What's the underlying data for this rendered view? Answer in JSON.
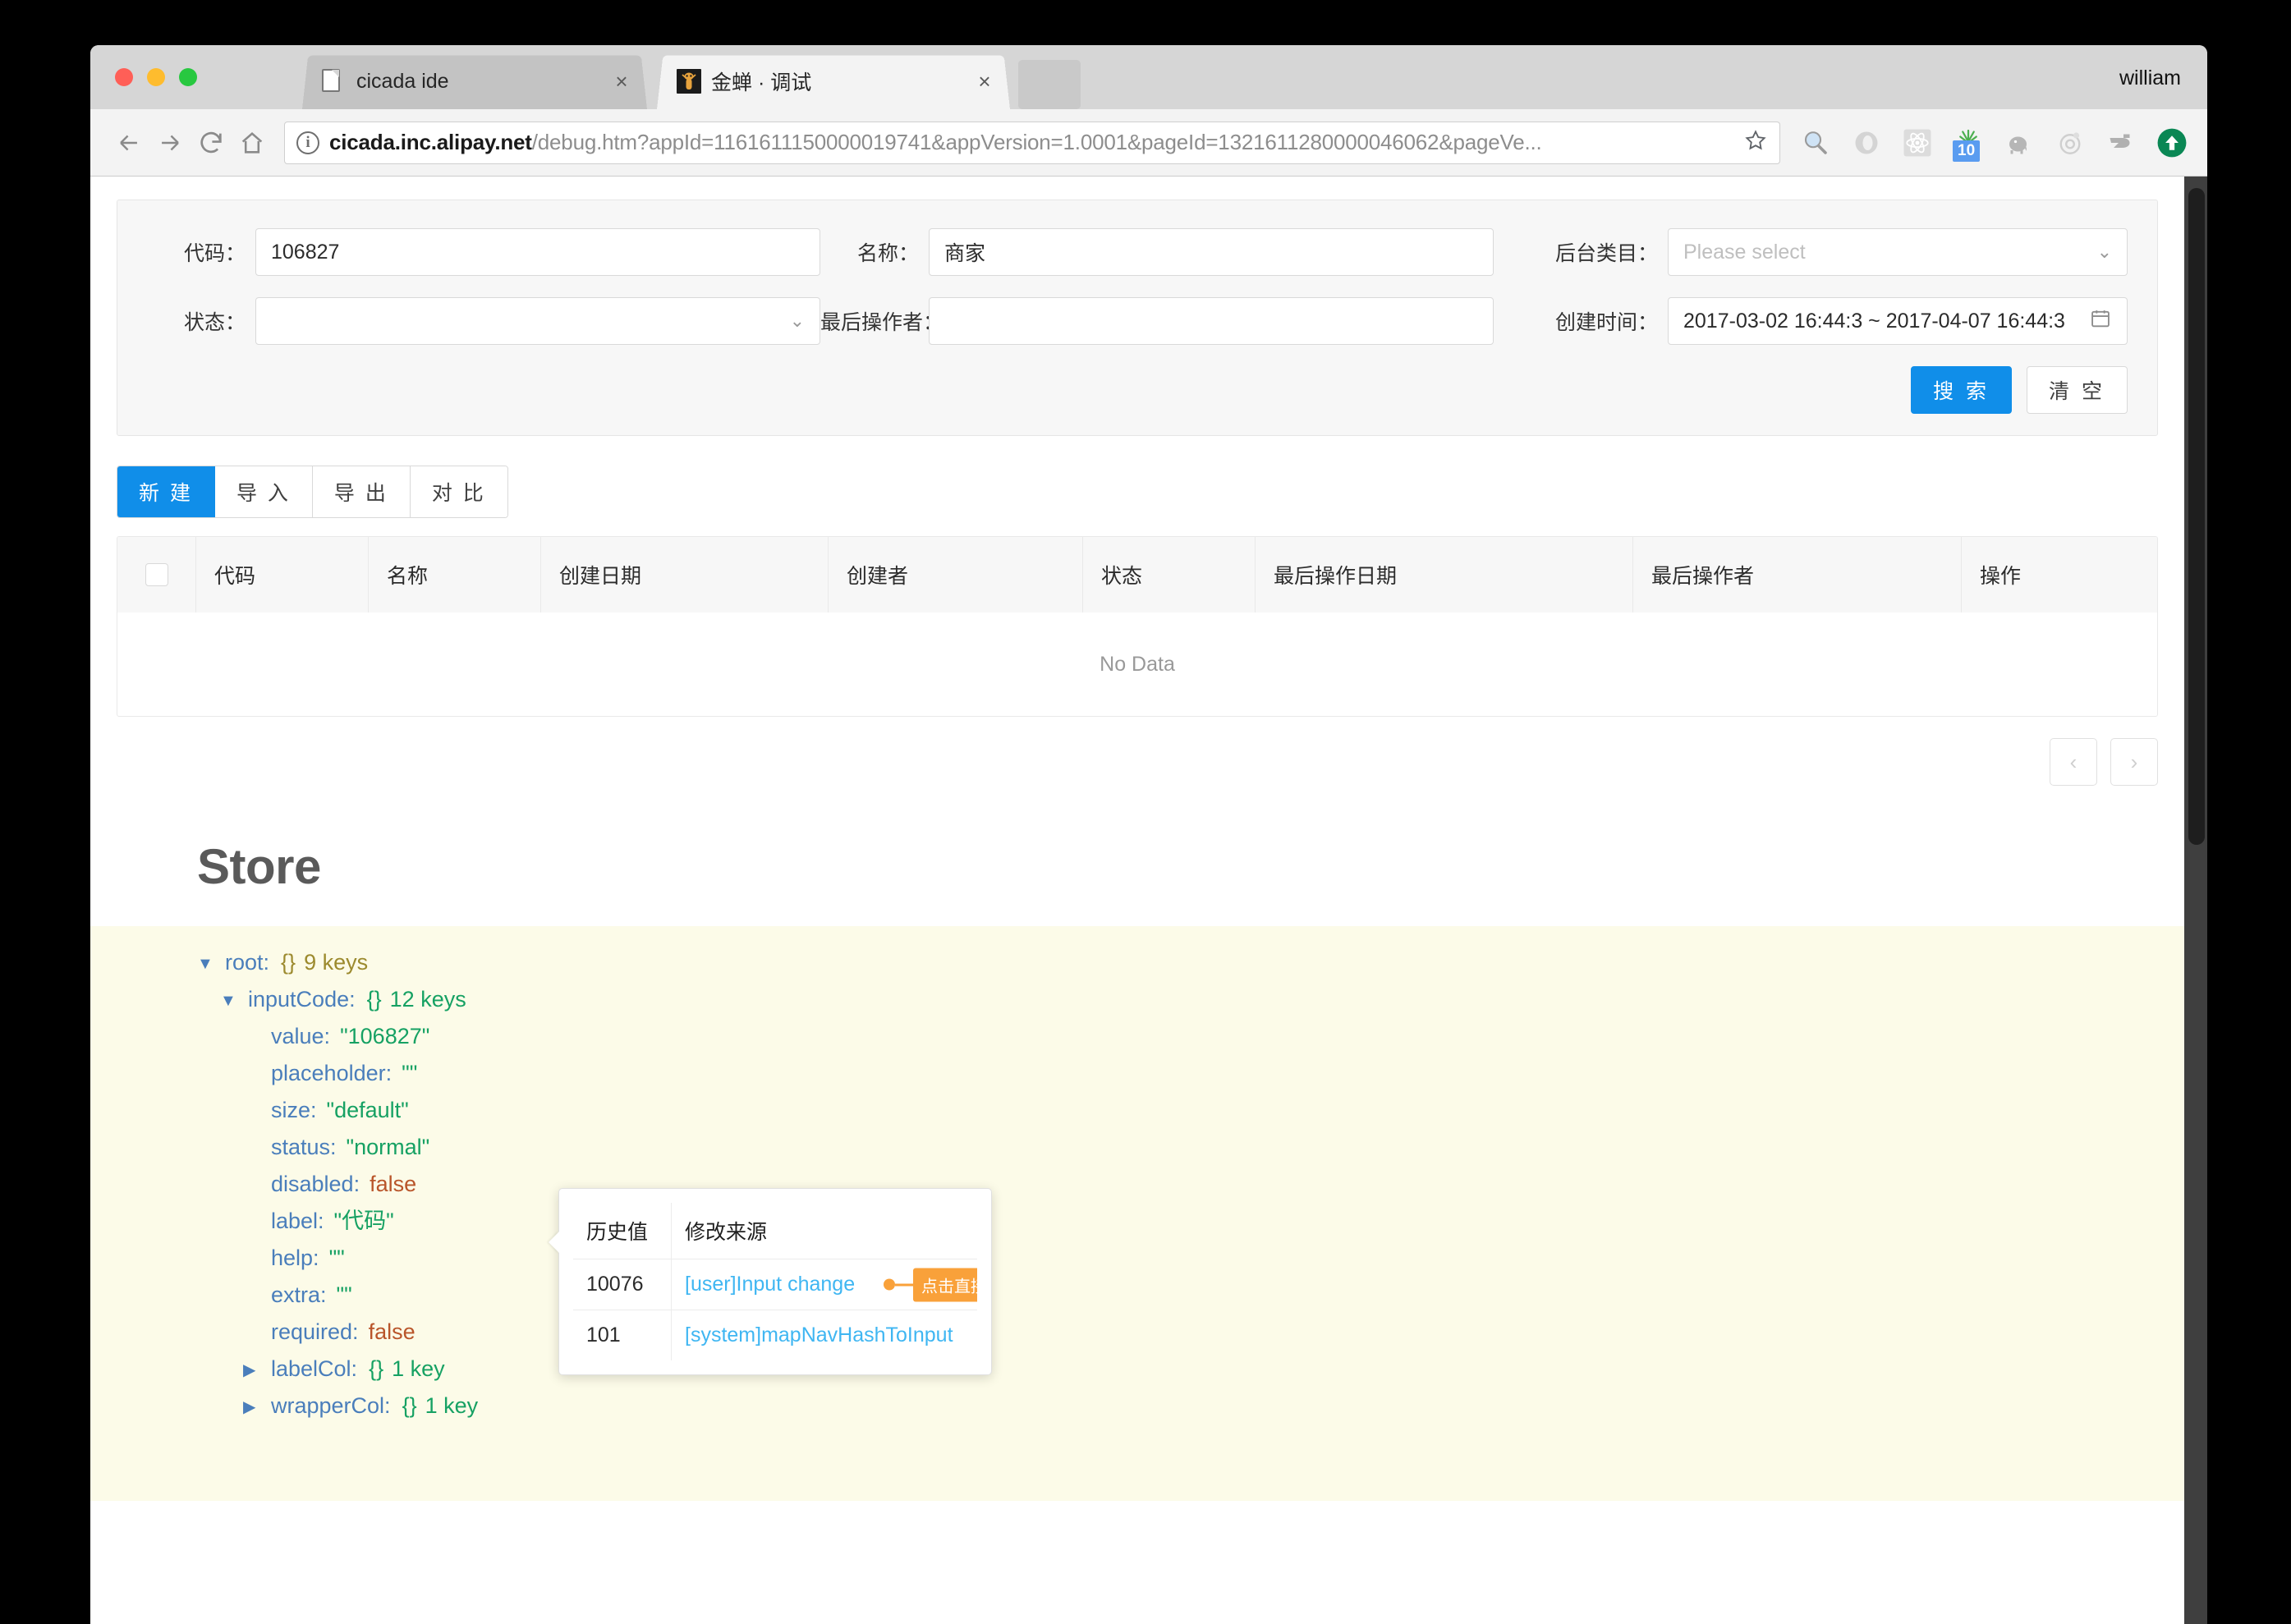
{
  "browser": {
    "profile_name": "william",
    "tabs": [
      {
        "title": "cicada ide",
        "favicon": "document-icon",
        "active": false,
        "close_label": "×"
      },
      {
        "title": "金蝉 · 调试",
        "favicon": "cicada-logo-icon",
        "active": true,
        "close_label": "×"
      }
    ],
    "new_tab_label": "",
    "omnibox": {
      "security_icon": "info-circle-icon",
      "host": "cicada.inc.alipay.net",
      "path": "/debug.htm?appId=1161611150000019741&appVersion=1.0001&pageId=1321611280000046062&pageVe...",
      "star_icon": "star-icon"
    },
    "nav": {
      "back_icon": "back-arrow-icon",
      "forward_icon": "forward-arrow-icon",
      "reload_icon": "reload-icon",
      "home_icon": "home-icon"
    },
    "extensions": [
      {
        "name": "magnifier-extension-icon",
        "badge": ""
      },
      {
        "name": "ring-extension-icon",
        "badge": ""
      },
      {
        "name": "react-devtools-icon",
        "badge": ""
      },
      {
        "name": "grass-extension-icon",
        "badge": "10"
      },
      {
        "name": "elephant-extension-icon",
        "badge": ""
      },
      {
        "name": "target-extension-icon",
        "badge": ""
      },
      {
        "name": "logo-extension-icon",
        "badge": ""
      },
      {
        "name": "upload-extension-icon",
        "badge": ""
      }
    ]
  },
  "search_form": {
    "fields": [
      {
        "label": "代码：",
        "value": "106827",
        "placeholder": "",
        "type": "text"
      },
      {
        "label": "名称：",
        "value": "商家",
        "placeholder": "",
        "type": "text"
      },
      {
        "label": "后台类目：",
        "value": "",
        "placeholder": "Please select",
        "type": "select"
      },
      {
        "label": "状态：",
        "value": "",
        "placeholder": "",
        "type": "select"
      },
      {
        "label": "最后操作者：",
        "value": "",
        "placeholder": "",
        "type": "text"
      },
      {
        "label": "创建时间：",
        "value": "2017-03-02 16:44:3 ~ 2017-04-07 16:44:3",
        "placeholder": "",
        "type": "daterange"
      }
    ],
    "search_button": "搜 索",
    "reset_button": "清 空"
  },
  "action_buttons": [
    {
      "label": "新 建",
      "active": true
    },
    {
      "label": "导 入",
      "active": false
    },
    {
      "label": "导 出",
      "active": false
    },
    {
      "label": "对 比",
      "active": false
    }
  ],
  "table": {
    "columns": [
      "",
      "代码",
      "名称",
      "创建日期",
      "创建者",
      "状态",
      "最后操作日期",
      "最后操作者",
      "操作"
    ],
    "rows": [],
    "empty_text": "No Data"
  },
  "pagination": {
    "prev_label": "‹",
    "next_label": "›"
  },
  "store": {
    "title": "Store",
    "tree": [
      {
        "indent": 0,
        "twisty": "▼",
        "key": "root:",
        "kind": "object",
        "brace": "{}",
        "count": "9 keys",
        "color": "olive"
      },
      {
        "indent": 1,
        "twisty": "▼",
        "key": "inputCode:",
        "kind": "object",
        "brace": "{}",
        "count": "12 keys",
        "color": "green"
      },
      {
        "indent": 2,
        "twisty": "",
        "key": "value:",
        "kind": "string",
        "value": "\"106827\""
      },
      {
        "indent": 2,
        "twisty": "",
        "key": "placeholder:",
        "kind": "string",
        "value": "\"\""
      },
      {
        "indent": 2,
        "twisty": "",
        "key": "size:",
        "kind": "string",
        "value": "\"default\""
      },
      {
        "indent": 2,
        "twisty": "",
        "key": "status:",
        "kind": "string",
        "value": "\"normal\""
      },
      {
        "indent": 2,
        "twisty": "",
        "key": "disabled:",
        "kind": "boolean",
        "value": "false"
      },
      {
        "indent": 2,
        "twisty": "",
        "key": "label:",
        "kind": "string",
        "value": "\"代码\""
      },
      {
        "indent": 2,
        "twisty": "",
        "key": "help:",
        "kind": "string",
        "value": "\"\""
      },
      {
        "indent": 2,
        "twisty": "",
        "key": "extra:",
        "kind": "string",
        "value": "\"\""
      },
      {
        "indent": 2,
        "twisty": "",
        "key": "required:",
        "kind": "boolean",
        "value": "false"
      },
      {
        "indent": 2,
        "twisty": "▶",
        "key": "labelCol:",
        "kind": "object",
        "brace": "{}",
        "count": "1 key",
        "color": "green"
      },
      {
        "indent": 2,
        "twisty": "▶",
        "key": "wrapperCol:",
        "kind": "object",
        "brace": "{}",
        "count": "1 key",
        "color": "green"
      }
    ]
  },
  "history_popup": {
    "columns": [
      "历史值",
      "修改来源"
    ],
    "rows": [
      {
        "value": "10076",
        "source": "[user]Input change",
        "callout": "点击直接打开"
      },
      {
        "value": "101",
        "source": "[system]mapNavHashToInput",
        "callout": ""
      }
    ]
  },
  "colors": {
    "primary": "#108ee9",
    "callout": "#f9a13a",
    "link": "#3fb6f2",
    "tree_bg": "#fcfbe8",
    "string": "#16a163",
    "boolean": "#b9552a",
    "key": "#4a7ebb"
  }
}
